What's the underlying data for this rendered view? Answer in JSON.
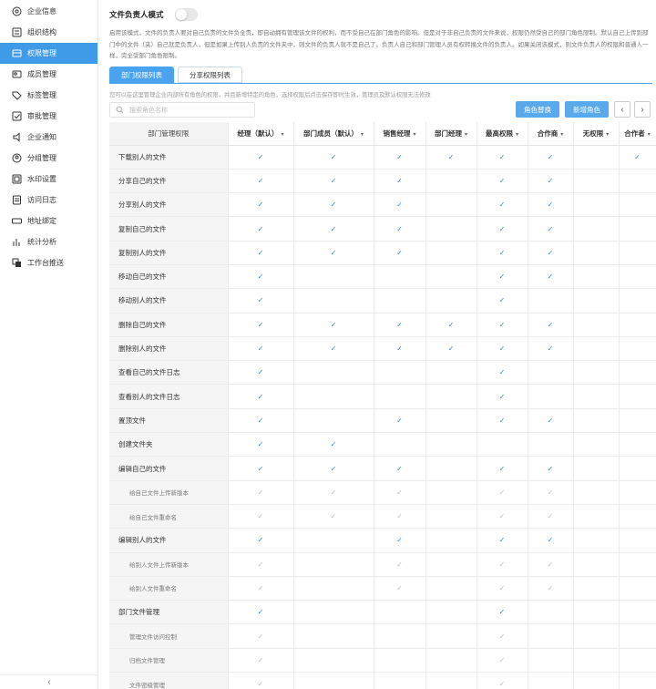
{
  "sidebar": {
    "items": [
      {
        "label": "企业信息",
        "icon": "settings-icon",
        "active": false
      },
      {
        "label": "组织结构",
        "icon": "org-icon",
        "active": false
      },
      {
        "label": "权限管理",
        "icon": "permission-icon",
        "active": true
      },
      {
        "label": "成员管理",
        "icon": "members-icon",
        "active": false
      },
      {
        "label": "标签管理",
        "icon": "tag-icon",
        "active": false
      },
      {
        "label": "审批管理",
        "icon": "approval-icon",
        "active": false
      },
      {
        "label": "企业通知",
        "icon": "notify-icon",
        "active": false
      },
      {
        "label": "分组管理",
        "icon": "group-icon",
        "active": false
      },
      {
        "label": "水印设置",
        "icon": "watermark-icon",
        "active": false
      },
      {
        "label": "访问日志",
        "icon": "log-icon",
        "active": false
      },
      {
        "label": "地址绑定",
        "icon": "mac-icon",
        "active": false
      },
      {
        "label": "统计分析",
        "icon": "chart-icon",
        "active": false
      },
      {
        "label": "工作台推送",
        "icon": "push-icon",
        "active": false
      }
    ],
    "collapse_label": "‹"
  },
  "mode": {
    "title": "文件负责人模式",
    "enabled": false,
    "description": "启用该模式，文件的负责人要对自己负责的文件负全责，即自动拥有管理该文件的权利，而不受自己在部门角色的影响。但是对于非自己负责的文件来说，权限仍然受自己的部门角色限制。默认自己上传到部门中的文件（夹）自己就是负责人，但是如果上传别人负责的文件夹中，则文件的负责人就不是自己了。负责人自己和部门管理人员有权转换文件的负责人。如果关闭该模式，则文件负责人的权限和普通人一样，完全受部门角色限制。"
  },
  "tabs": [
    {
      "label": "部门权限列表",
      "active": true
    },
    {
      "label": "分享权限列表",
      "active": false
    }
  ],
  "hint": "您可以在这里管理企业内部所有角色的权限，并且新增特定的角色，选择权限后点击保存即时生效，管理员及默认权限无法修改",
  "search": {
    "placeholder": "搜索角色名称"
  },
  "buttons": {
    "role_replace": "角色替换",
    "new_role": "新增角色",
    "prev": "‹",
    "next": "›"
  },
  "table": {
    "header_first": "部门管理权限",
    "columns": [
      "经理（默认）",
      "部门成员（默认）",
      "销售经理",
      "部门经理",
      "最高权限",
      "合作商",
      "无权限",
      "合作者"
    ],
    "check_glyph": "✓",
    "rows": [
      {
        "name": "下载别人的文件",
        "sub": false,
        "checks": [
          1,
          1,
          1,
          1,
          1,
          1,
          0,
          1
        ]
      },
      {
        "name": "分享自己的文件",
        "sub": false,
        "checks": [
          1,
          1,
          1,
          0,
          1,
          1,
          0,
          0
        ]
      },
      {
        "name": "分享别人的文件",
        "sub": false,
        "checks": [
          1,
          1,
          1,
          0,
          1,
          1,
          0,
          0
        ]
      },
      {
        "name": "复制自己的文件",
        "sub": false,
        "checks": [
          1,
          1,
          1,
          0,
          1,
          1,
          0,
          0
        ]
      },
      {
        "name": "复制别人的文件",
        "sub": false,
        "checks": [
          1,
          1,
          1,
          0,
          1,
          1,
          0,
          0
        ]
      },
      {
        "name": "移动自己的文件",
        "sub": false,
        "checks": [
          1,
          0,
          0,
          0,
          1,
          1,
          0,
          0
        ]
      },
      {
        "name": "移动别人的文件",
        "sub": false,
        "checks": [
          1,
          0,
          0,
          0,
          1,
          0,
          0,
          0
        ]
      },
      {
        "name": "删除自己的文件",
        "sub": false,
        "checks": [
          1,
          1,
          1,
          1,
          1,
          1,
          0,
          0
        ]
      },
      {
        "name": "删除别人的文件",
        "sub": false,
        "checks": [
          1,
          1,
          1,
          1,
          1,
          1,
          0,
          0
        ]
      },
      {
        "name": "查看自己的文件日志",
        "sub": false,
        "checks": [
          1,
          0,
          0,
          0,
          1,
          0,
          0,
          0
        ]
      },
      {
        "name": "查看别人的文件日志",
        "sub": false,
        "checks": [
          1,
          0,
          0,
          0,
          1,
          0,
          0,
          0
        ]
      },
      {
        "name": "置顶文件",
        "sub": false,
        "checks": [
          1,
          0,
          1,
          0,
          1,
          1,
          0,
          0
        ]
      },
      {
        "name": "创建文件夹",
        "sub": false,
        "checks": [
          1,
          1,
          0,
          0,
          0,
          0,
          0,
          0
        ]
      },
      {
        "name": "编辑自己的文件",
        "sub": false,
        "checks": [
          1,
          1,
          1,
          0,
          1,
          1,
          0,
          0
        ]
      },
      {
        "name": "给自己文件上传新版本",
        "sub": true,
        "checks": [
          1,
          1,
          1,
          0,
          1,
          1,
          0,
          0
        ]
      },
      {
        "name": "给自己文件重命名",
        "sub": true,
        "checks": [
          1,
          1,
          1,
          0,
          1,
          1,
          0,
          0
        ]
      },
      {
        "name": "编辑别人的文件",
        "sub": false,
        "checks": [
          1,
          0,
          1,
          0,
          1,
          1,
          0,
          0
        ]
      },
      {
        "name": "给别人文件上传新版本",
        "sub": true,
        "checks": [
          1,
          0,
          1,
          0,
          1,
          1,
          0,
          0
        ]
      },
      {
        "name": "给别人文件重命名",
        "sub": true,
        "checks": [
          1,
          0,
          1,
          0,
          1,
          1,
          0,
          0
        ]
      },
      {
        "name": "部门文件管理",
        "sub": false,
        "checks": [
          1,
          0,
          0,
          0,
          1,
          0,
          0,
          0
        ]
      },
      {
        "name": "管理文件访问控制",
        "sub": true,
        "checks": [
          1,
          0,
          0,
          0,
          1,
          0,
          0,
          0
        ]
      },
      {
        "name": "归档文件管理",
        "sub": true,
        "checks": [
          1,
          0,
          0,
          0,
          1,
          0,
          0,
          0
        ]
      },
      {
        "name": "文件密级管理",
        "sub": true,
        "checks": [
          1,
          0,
          0,
          0,
          1,
          0,
          0,
          0
        ]
      }
    ]
  },
  "colors": {
    "accent": "#4aa3ee",
    "check": "#3f86d6",
    "check_sub": "#bdbdbd"
  }
}
